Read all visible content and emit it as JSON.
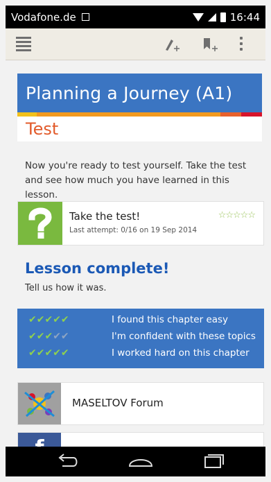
{
  "status_bar": {
    "carrier": "Vodafone.de",
    "time": "16:44"
  },
  "lesson": {
    "title": "Planning a Journey (A1)",
    "subtitle": "Test",
    "intro": "Now you're ready to test yourself. Take the test and see how much you have learned in this lesson."
  },
  "test_card": {
    "title": "Take the test!",
    "meta": "Last attempt: 0/16 on 19 Sep 2014",
    "stars": "☆☆☆☆☆"
  },
  "complete": {
    "heading": "Lesson complete!",
    "prompt": "Tell us how it was."
  },
  "feedback": [
    {
      "label": "I found this chapter easy",
      "rating": 5
    },
    {
      "label": "I'm confident with these topics",
      "rating": 3
    },
    {
      "label": "I worked hard on this chapter",
      "rating": 5
    }
  ],
  "forum": {
    "label": "MASELTOV Forum"
  },
  "facebook": {
    "logo_letter": "f"
  },
  "colors": {
    "accent_blue": "#3b75c2",
    "strip": [
      "#f3c11b",
      "#f39a1e",
      "#e8612c",
      "#d7142b"
    ]
  }
}
